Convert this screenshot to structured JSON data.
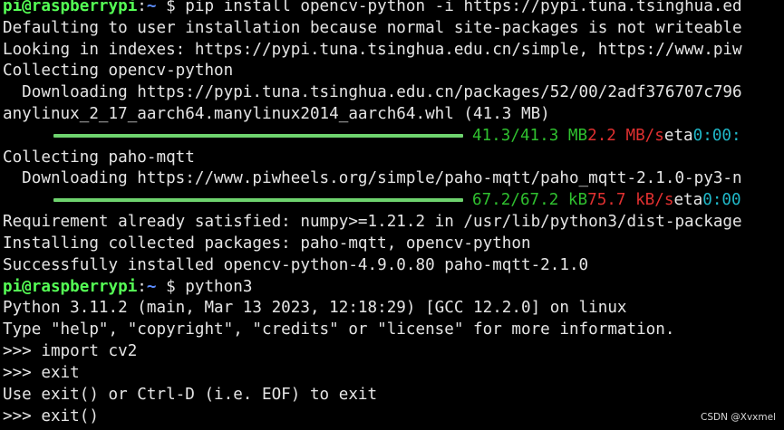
{
  "prompt": {
    "user_host": "pi@raspberrypi",
    "separator": ":",
    "path": "~",
    "dollar": " $ "
  },
  "lines": {
    "cmd1": "pip install opencv-python -i https://pypi.tuna.tsinghua.ed",
    "l2": "Defaulting to user installation because normal site-packages is not writeable",
    "l3": "Looking in indexes: https://pypi.tuna.tsinghua.edu.cn/simple, https://www.piw",
    "l4": "Collecting opencv-python",
    "l5": "  Downloading https://pypi.tuna.tsinghua.edu.cn/packages/52/00/2adf376707c796",
    "l6": "anylinux_2_17_aarch64.manylinux2014_aarch64.whl (41.3 MB)",
    "l8": "Collecting paho-mqtt",
    "l9": "  Downloading https://www.piwheels.org/simple/paho-mqtt/paho_mqtt-2.1.0-py3-n",
    "l11": "Requirement already satisfied: numpy>=1.21.2 in /usr/lib/python3/dist-package",
    "l12": "Installing collected packages: paho-mqtt, opencv-python",
    "l13": "Successfully installed opencv-python-4.9.0.80 paho-mqtt-2.1.0",
    "cmd2": "python3",
    "l15": "Python 3.11.2 (main, Mar 13 2023, 12:18:29) [GCC 12.2.0] on linux",
    "l16": "Type \"help\", \"copyright\", \"credits\" or \"license\" for more information.",
    "l17": ">>> import cv2",
    "l18": ">>> exit",
    "l19": "Use exit() or Ctrl-D (i.e. EOF) to exit",
    "l20": ">>> exit()"
  },
  "progress": [
    {
      "fraction": 1.0,
      "amount": "41.3/41.3 MB",
      "speed": "2.2 MB/s",
      "eta_label": "eta",
      "eta": "0:00:"
    },
    {
      "fraction": 1.0,
      "amount": "67.2/67.2 kB",
      "speed": "75.7 kB/s",
      "eta_label": "eta",
      "eta": "0:00"
    }
  ],
  "watermark": "CSDN @Xvxmel",
  "colors": {
    "background": "#000000",
    "text": "#e5e5e5",
    "prompt_user": "#55ff55",
    "prompt_path": "#5c8cff",
    "progress_bar": "#6ed36e",
    "amount": "#2fc02f",
    "speed": "#e03030",
    "eta": "#20b8c8"
  }
}
